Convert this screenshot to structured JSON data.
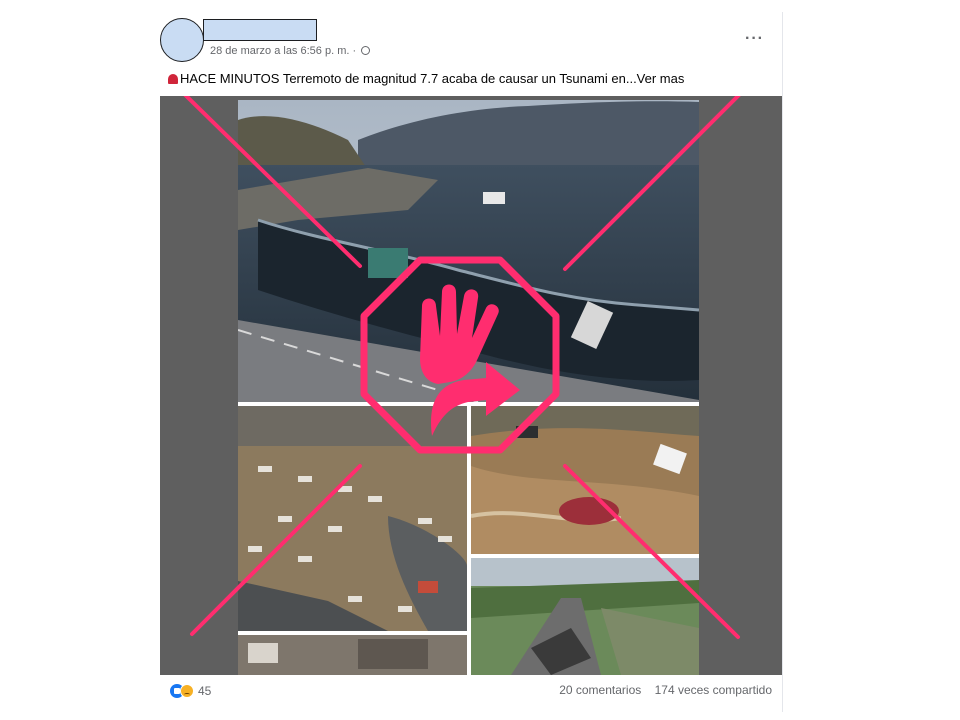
{
  "post": {
    "timestamp": "28 de marzo a las 6:56 p. m. ·",
    "privacy_icon": "globe-icon",
    "more_options_label": "···",
    "text": "HACE MINUTOS Terremoto de magnitud 7.7 acaba de causar un Tsunami en...Ver mas",
    "text_icon": "siren-icon"
  },
  "overlay": {
    "stamp_icon": "stop-hand-icon",
    "stamp_color": "#ff2d6f",
    "cross_color": "#ff2d6f"
  },
  "footer": {
    "reaction_icons": [
      "like-icon",
      "sad-icon"
    ],
    "reaction_count": "45",
    "comments": "20 comentarios",
    "shares": "174 veces compartido"
  },
  "colors": {
    "background": "#ffffff",
    "media_background": "#5f5f5f",
    "meta_text": "#65676b",
    "accent": "#ff2d6f"
  }
}
